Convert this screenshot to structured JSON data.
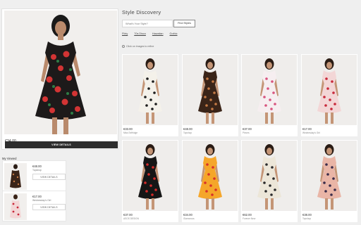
{
  "featured": {
    "price": "€34.00",
    "brand": "ASOS DESIGN",
    "button_label": "VIEW DETAILS"
  },
  "my_viewed": {
    "title": "My Viewed",
    "items": [
      {
        "price": "€48.00",
        "brand": "Topshop",
        "button_label": "VIEW DETAILS"
      },
      {
        "price": "€17.00",
        "brand": "Wednesday's Girl",
        "button_label": "VIEW DETAILS"
      }
    ]
  },
  "discovery": {
    "title": "Style Discovery",
    "search_placeholder": "What's Your Style?",
    "find_button": "Find Styles",
    "filters": [
      "Flirty",
      "70s Disco",
      "Hawaiian",
      "Gothic"
    ],
    "hint": "Click on images to refine"
  },
  "products": [
    {
      "price": "€33.00",
      "brand": "Miss Selfridge",
      "palette": [
        "#f4f1ea",
        "#1c1c1c"
      ]
    },
    {
      "price": "€48.00",
      "brand": "Topshop",
      "palette": [
        "#3a2418",
        "#c57a45"
      ]
    },
    {
      "price": "€37.00",
      "brand": "Pieces",
      "palette": [
        "#f6eef0",
        "#d8547e"
      ]
    },
    {
      "price": "€17.00",
      "brand": "Wednesday's Girl",
      "palette": [
        "#f3d6d6",
        "#c8283a"
      ]
    },
    {
      "price": "€37.00",
      "brand": "ASOS DESIGN",
      "palette": [
        "#161616",
        "#d42a2a"
      ]
    },
    {
      "price": "€34.00",
      "brand": "Glamorous",
      "palette": [
        "#f5a62a",
        "#d8302a"
      ]
    },
    {
      "price": "€62.00",
      "brand": "Forever New",
      "palette": [
        "#ece6d8",
        "#2b2b2b"
      ]
    },
    {
      "price": "€38.00",
      "brand": "Topshop",
      "palette": [
        "#e9b5a6",
        "#3a2c4a"
      ]
    }
  ]
}
